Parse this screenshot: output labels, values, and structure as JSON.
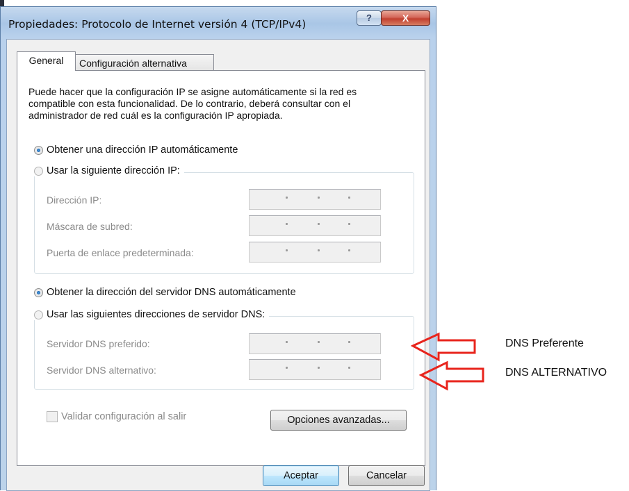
{
  "window": {
    "title": "Propiedades: Protocolo de Internet versión 4 (TCP/IPv4)",
    "help_glyph": "?",
    "close_glyph": "X"
  },
  "tabs": [
    {
      "label": "General",
      "active": true
    },
    {
      "label": "Configuración alternativa",
      "active": false
    }
  ],
  "description": "Puede hacer que la configuración IP se asigne automáticamente si la red es compatible con esta funcionalidad. De lo contrario, deberá consultar con el administrador de red cuál es la configuración IP apropiada.",
  "ip": {
    "auto_label": "Obtener una dirección IP automáticamente",
    "auto_checked": true,
    "manual_label": "Usar la siguiente dirección IP:",
    "manual_checked": false,
    "fields": [
      {
        "label": "Dirección IP:",
        "value": ". . ."
      },
      {
        "label": "Máscara de subred:",
        "value": ". . ."
      },
      {
        "label": "Puerta de enlace predeterminada:",
        "value": ". . ."
      }
    ]
  },
  "dns": {
    "auto_label": "Obtener la dirección del servidor DNS automáticamente",
    "auto_checked": true,
    "manual_label": "Usar las siguientes direcciones de servidor DNS:",
    "manual_checked": false,
    "fields": [
      {
        "label": "Servidor DNS preferido:",
        "value": ". . ."
      },
      {
        "label": "Servidor DNS alternativo:",
        "value": ". . ."
      }
    ]
  },
  "validate": {
    "label": "Validar configuración al salir",
    "checked": false
  },
  "buttons": {
    "advanced": "Opciones avanzadas...",
    "ok": "Aceptar",
    "cancel": "Cancelar"
  },
  "annotations": {
    "preferred": "DNS Preferente",
    "alternate": "DNS ALTERNATIVO",
    "arrow_color": "#e8241c"
  }
}
